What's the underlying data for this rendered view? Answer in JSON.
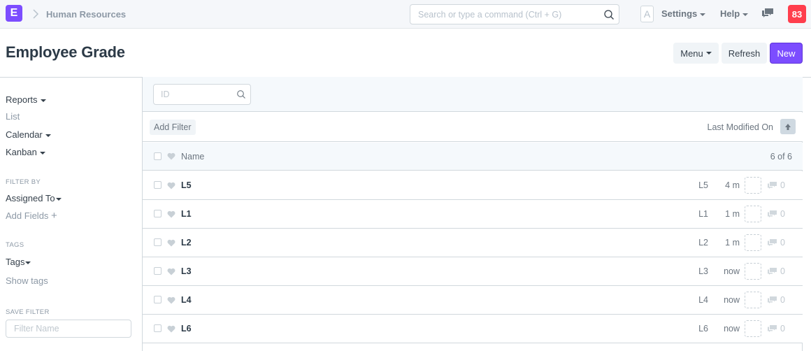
{
  "navbar": {
    "logo_letter": "E",
    "breadcrumb": "Human Resources",
    "search_placeholder": "Search or type a command (Ctrl + G)",
    "avatar_letter": "A",
    "settings_label": "Settings",
    "help_label": "Help",
    "notification_count": "83"
  },
  "page": {
    "title": "Employee Grade",
    "menu_label": "Menu",
    "refresh_label": "Refresh",
    "new_label": "New"
  },
  "sidebar": {
    "views": [
      {
        "label": "Reports",
        "dropdown": true
      },
      {
        "label": "List",
        "dropdown": false
      },
      {
        "label": "Calendar",
        "dropdown": true
      },
      {
        "label": "Kanban",
        "dropdown": true
      }
    ],
    "filter_by_label": "FILTER BY",
    "assigned_to_label": "Assigned To",
    "add_fields_label": "Add Fields",
    "tags_section_label": "TAGS",
    "tags_label": "Tags",
    "show_tags_label": "Show tags",
    "save_filter_label": "SAVE FILTER",
    "filter_name_placeholder": "Filter Name"
  },
  "list": {
    "id_placeholder": "ID",
    "add_filter_label": "Add Filter",
    "sort_label": "Last Modified On",
    "header_name": "Name",
    "count_text": "6 of 6",
    "rows": [
      {
        "name": "L5",
        "code": "L5",
        "modified": "4 m",
        "comments": "0"
      },
      {
        "name": "L1",
        "code": "L1",
        "modified": "1 m",
        "comments": "0"
      },
      {
        "name": "L2",
        "code": "L2",
        "modified": "1 m",
        "comments": "0"
      },
      {
        "name": "L3",
        "code": "L3",
        "modified": "now",
        "comments": "0"
      },
      {
        "name": "L4",
        "code": "L4",
        "modified": "now",
        "comments": "0"
      },
      {
        "name": "L6",
        "code": "L6",
        "modified": "now",
        "comments": "0"
      }
    ]
  },
  "colors": {
    "brand": "#7c4dff",
    "notification": "#ff3e4d"
  }
}
